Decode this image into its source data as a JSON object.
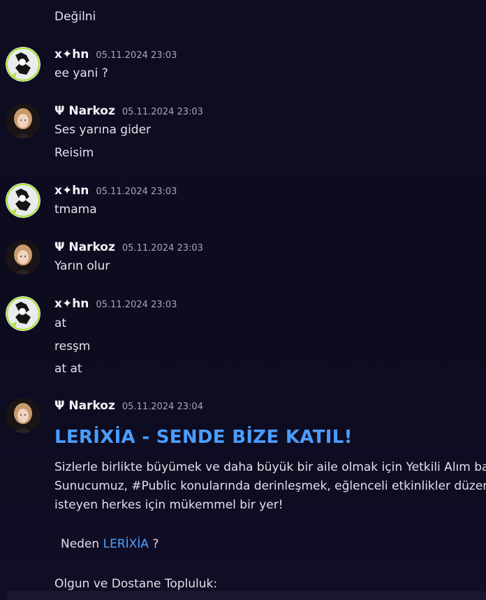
{
  "users": {
    "xhn": "x✦hn",
    "narkoz": "Ψ Narkoz"
  },
  "messages": {
    "first_line": "Değilni",
    "m1": {
      "author": "x✦hn",
      "time": "05.11.2024 23:03",
      "lines": [
        "ee yani ?"
      ]
    },
    "m2": {
      "author": "Ψ Narkoz",
      "time": "05.11.2024 23:03",
      "lines": [
        "Ses yarına gider",
        "Reisim"
      ]
    },
    "m3": {
      "author": "x✦hn",
      "time": "05.11.2024 23:03",
      "lines": [
        "tmama"
      ]
    },
    "m4": {
      "author": "Ψ Narkoz",
      "time": "05.11.2024 23:03",
      "lines": [
        "Yarın olur"
      ]
    },
    "m5": {
      "author": "x✦hn",
      "time": "05.11.2024 23:03",
      "lines": [
        "at",
        "resşm",
        "at at"
      ]
    },
    "m6": {
      "author": "Ψ Narkoz",
      "time": "05.11.2024 23:04"
    }
  },
  "embed": {
    "title": "LERİXİA - SENDE BİZE KATIL!",
    "para_line1": "Sizlerle birlikte büyümek ve daha büyük bir aile olmak için Yetkili Alım baş",
    "para_line2": "Sunucumuz, #Public konularında derinleşmek, eğlenceli etkinlikler düzenl",
    "para_line3": "isteyen herkes için mükemmel bir yer!",
    "neden_prefix": "Neden ",
    "neden_link": "LERİXİA",
    "neden_suffix": " ?",
    "section": "Olgun ve Dostane Topluluk:"
  },
  "colors": {
    "background": "#0d0b1e",
    "accent_link": "#4b9dff",
    "text": "#e1e3ea",
    "timestamp": "#a5a8b4"
  }
}
